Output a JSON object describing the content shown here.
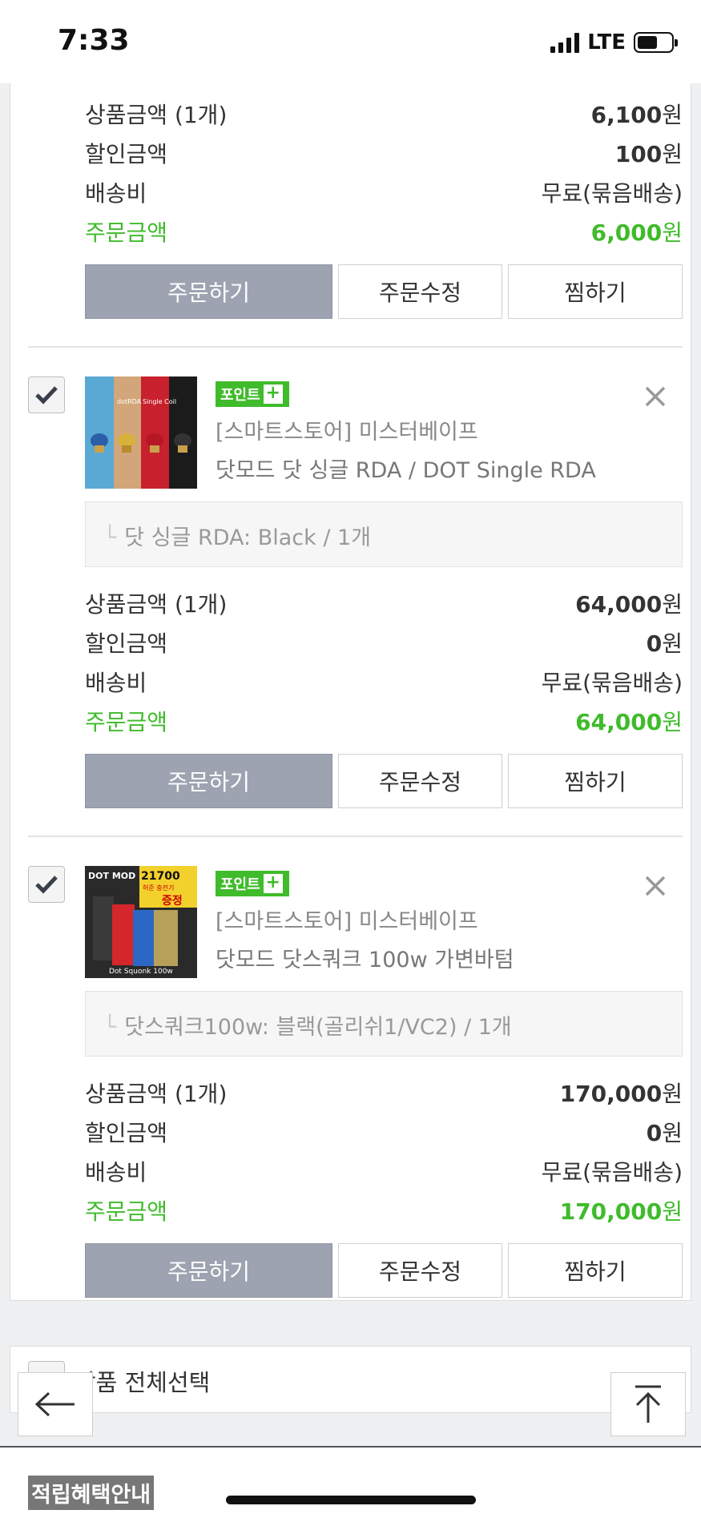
{
  "status_bar": {
    "time": "7:33",
    "network": "LTE"
  },
  "labels": {
    "product_amount": "상품금액 (1개)",
    "discount": "할인금액",
    "shipping": "배송비",
    "order_amount": "주문금액",
    "order_button": "주문하기",
    "edit_button": "주문수정",
    "wish_button": "찜하기",
    "point_badge": "포인트",
    "point_plus": "+",
    "won": "원"
  },
  "first_item_summary": {
    "product_amount": "6,100",
    "discount": "100",
    "shipping": "무료(묶음배송)",
    "order_amount": "6,000"
  },
  "items": [
    {
      "store": "[스마트스토어] 미스터베이프",
      "name": "닷모드 닷 싱글 RDA / DOT Single RDA",
      "option": "닷 싱글 RDA: Black / 1개",
      "product_amount": "64,000",
      "discount": "0",
      "shipping": "무료(묶음배송)",
      "order_amount": "64,000",
      "thumb_text": [
        "dotRDA",
        "Single Coil"
      ]
    },
    {
      "store": "[스마트스토어] 미스터베이프",
      "name": "닷모드 닷스쿼크 100w 가변바텀",
      "option": "닷스쿼크100w: 블랙(골리쉬1/VC2) / 1개",
      "product_amount": "170,000",
      "discount": "0",
      "shipping": "무료(묶음배송)",
      "order_amount": "170,000",
      "thumb_text": [
        "DOT MOD",
        "21700",
        "허준 충전기",
        "증정",
        "Dot Squonk 100w"
      ]
    }
  ],
  "select_all_label": "상품 전체선택",
  "point_guide": "적립혜택안내",
  "colors": {
    "accent_green": "#3fbb2b",
    "primary_button": "#9da3b0"
  },
  "icons": [
    "check-icon",
    "close-icon",
    "back-arrow-icon",
    "scroll-top-icon"
  ]
}
